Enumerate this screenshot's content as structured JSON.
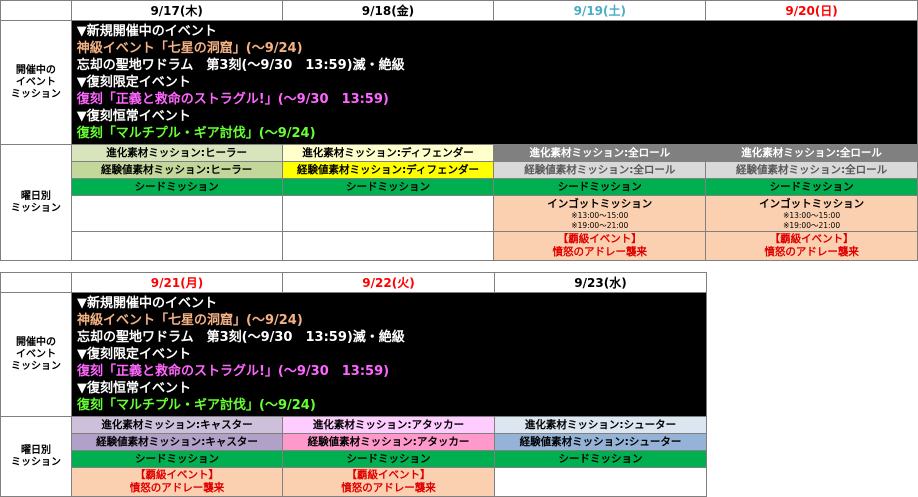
{
  "colors": {
    "black": "#000000",
    "sat": "#4bacc6",
    "red": "#ff0000",
    "heal": "#d8e4bc",
    "def": "#ffff00",
    "all": "#a6a6a6",
    "all2": "#d9d9d9",
    "seed": "#00b050",
    "ingot": "#fbd0b0",
    "caster": "#b1a0c7",
    "attacker": "#ff99cc",
    "shooter": "#95b3d7"
  },
  "labels": {
    "event": "開催中の\nイベント\nミッション",
    "daily": "曜日別\nミッション"
  },
  "event_lines": {
    "h1": "▼新規開催中のイベント",
    "l1": "神級イベント「七星の洞窟」(～9/24)",
    "l2": "忘却の聖地ワドラム　第3刻(～9/30　13:59)滅・絶級",
    "h2": "▼復刻限定イベント",
    "l3": "復刻「正義と救命のストラグル!」(～9/30　13:59)",
    "h3": "▼復刻恒常イベント",
    "l4": "復刻「マルチプル・ギア討伐」(～9/24)"
  },
  "week1": {
    "dates": [
      "9/17(木)",
      "9/18(金)",
      "9/19(土)",
      "9/20(日)"
    ],
    "evo": [
      "進化素材ミッション:ヒーラー",
      "進化素材ミッション:ディフェンダー",
      "進化素材ミッション:全ロール",
      "進化素材ミッション:全ロール"
    ],
    "exp": [
      "経験値素材ミッション:ヒーラー",
      "経験値素材ミッション:ディフェンダー",
      "経験値素材ミッション:全ロール",
      "経験値素材ミッション:全ロール"
    ],
    "seed": "シードミッション",
    "ingot_title": "インゴットミッション",
    "ingot_t1": "※13:00～15:00",
    "ingot_t2": "※19:00～21:00",
    "raid_1": "【覇級イベント】",
    "raid_2": "憤怒のアドレー襲来"
  },
  "week2": {
    "dates": [
      "9/21(月)",
      "9/22(火)",
      "9/23(水)"
    ],
    "evo": [
      "進化素材ミッション:キャスター",
      "進化素材ミッション:アタッカー",
      "進化素材ミッション:シューター"
    ],
    "exp": [
      "経験値素材ミッション:キャスター",
      "経験値素材ミッション:アタッカー",
      "経験値素材ミッション:シューター"
    ],
    "seed": "シードミッション",
    "raid_1": "【覇級イベント】",
    "raid_2": "憤怒のアドレー襲来"
  }
}
